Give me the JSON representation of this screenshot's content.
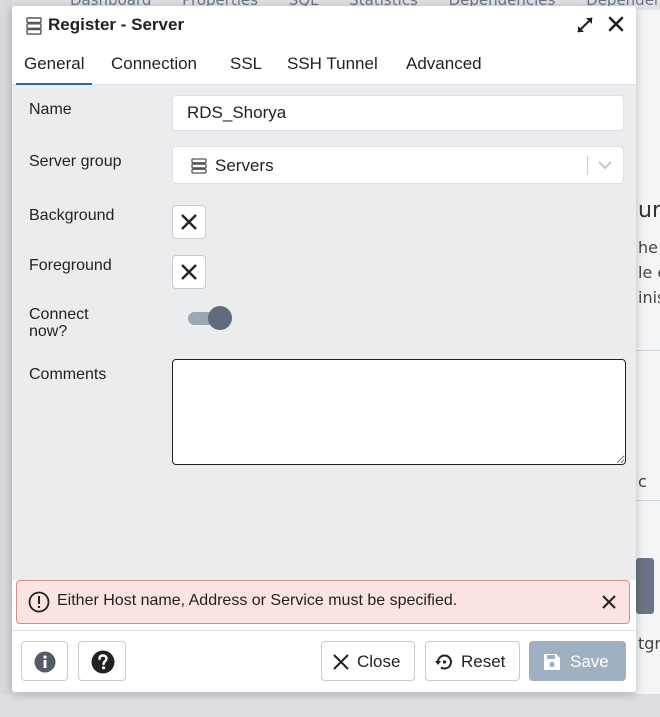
{
  "background": {
    "tabs": [
      "Dashboard",
      "Properties",
      "SQL",
      "Statistics",
      "Dependencies",
      "Dependents"
    ],
    "right_fragments": [
      "ur",
      "he",
      "le c",
      "inis",
      "c",
      "tgre"
    ]
  },
  "dialog": {
    "title": "Register - Server",
    "tabs": [
      {
        "label": "General",
        "active": true
      },
      {
        "label": "Connection",
        "active": false
      },
      {
        "label": "SSL",
        "active": false
      },
      {
        "label": "SSH Tunnel",
        "active": false
      },
      {
        "label": "Advanced",
        "active": false
      }
    ],
    "form": {
      "name_label": "Name",
      "name_value": "RDS_Shorya",
      "server_group_label": "Server group",
      "server_group_value": "Servers",
      "background_label": "Background",
      "foreground_label": "Foreground",
      "connect_now_label": "Connect now?",
      "connect_now_on": true,
      "comments_label": "Comments",
      "comments_value": ""
    },
    "alert": {
      "message": "Either Host name, Address or Service must be specified.",
      "status_color": "#fae3e1"
    },
    "footer": {
      "close_label": "Close",
      "reset_label": "Reset",
      "save_label": "Save"
    }
  },
  "colors": {
    "accent": "#326690",
    "save_disabled": "#9fb0c1",
    "toggle_knob": "#5f6b7b"
  },
  "icons": [
    "server-group-icon",
    "expand-icon",
    "close-icon",
    "x-icon",
    "alert-circle-icon",
    "info-icon",
    "help-icon",
    "reset-icon",
    "save-icon",
    "chevron-down-icon"
  ]
}
